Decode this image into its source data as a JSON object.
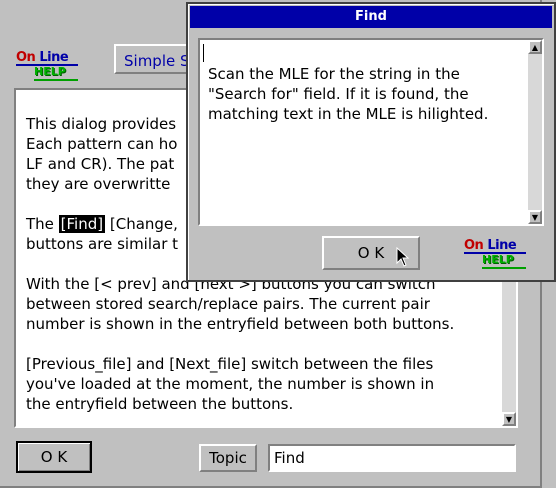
{
  "help_window": {
    "logo": {
      "line1a": "On ",
      "line1b": "Line",
      "line2": "HELP"
    },
    "title_button": "Simple S",
    "text": {
      "p1": [
        "This dialog provides",
        "Each pattern can ho",
        "LF and CR). The pat",
        "they are overwritte"
      ],
      "p2_prefix": "The ",
      "p2_find": "[Find]",
      "p2_rest1": " [Change,",
      "p2_line2": "buttons are similar t",
      "p3": [
        "With the [< prev] and [next >] buttons you can switch",
        "between stored search/replace pairs. The current pair",
        "number is shown in the entryfield between both buttons."
      ],
      "p4": [
        "[Previous_file] and [Next_file] switch between the files",
        "you've loaded at the moment, the number is shown in",
        "the entryfield between the buttons."
      ]
    },
    "ok_label": "O K",
    "topic_label": "Topic",
    "topic_value": "Find"
  },
  "find_dialog": {
    "title": "Find",
    "text": [
      "Scan the MLE for the string in the",
      "\"Search for\" field. If it is found, the",
      "matching text in the MLE is hilighted."
    ],
    "ok_label": "O K",
    "logo": {
      "line1a": "On ",
      "line1b": "Line",
      "line2": "HELP"
    }
  },
  "icons": {
    "scroll_up": "up-arrow-icon",
    "scroll_down": "down-arrow-icon",
    "pointer": "mouse-pointer-icon"
  }
}
